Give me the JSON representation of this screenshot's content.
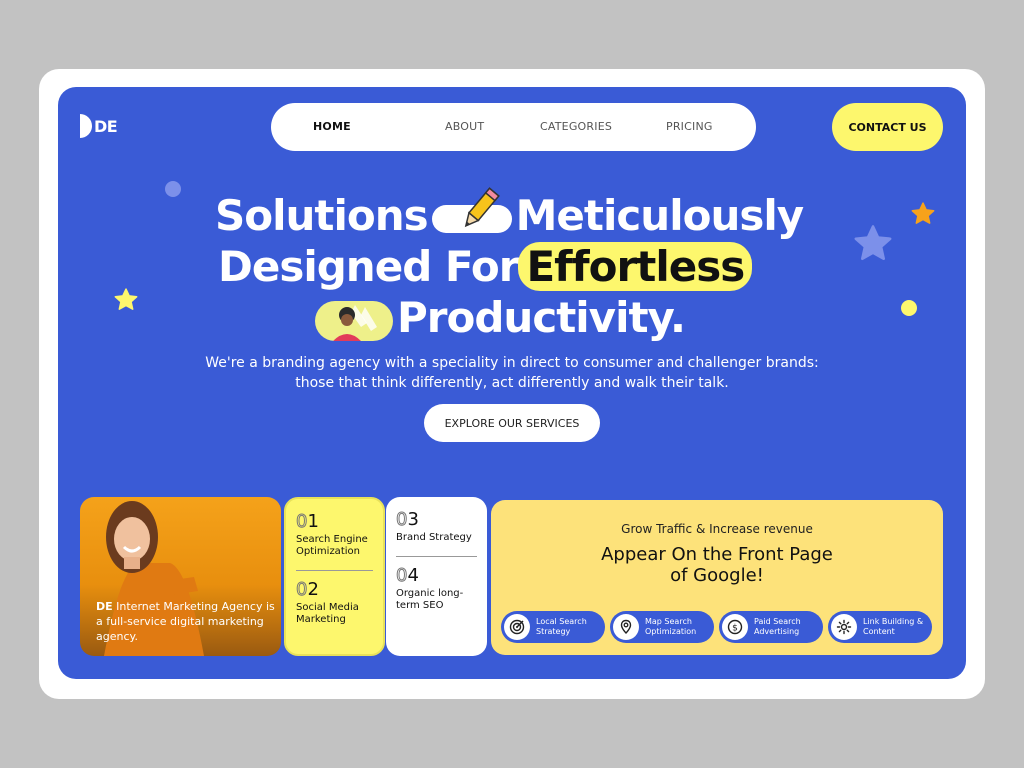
{
  "logo": {
    "text": "DE"
  },
  "nav": {
    "items": [
      {
        "label": "HOME",
        "active": true
      },
      {
        "label": "ABOUT",
        "active": false
      },
      {
        "label": "CATEGORIES",
        "active": false
      },
      {
        "label": "PRICING",
        "active": false
      }
    ]
  },
  "contact_button": "CONTACT US",
  "hero": {
    "headline_line1_a": "Solutions",
    "headline_line1_b": "Meticulously",
    "headline_line2_a": "Designed For",
    "headline_line2_b": "Effortless",
    "headline_line3": "Productivity.",
    "subtitle": "We're a branding agency with a speciality in direct to consumer and challenger brands: those that think differently, act differently and walk their talk.",
    "cta": "EXPLORE OUR SERVICES"
  },
  "agency_card": {
    "brand": "DE",
    "text": " Internet Marketing Agency is a full-service digital marketing agency."
  },
  "services": [
    {
      "num_ghost": "0",
      "num": "1",
      "label": "Search Engine Optimization"
    },
    {
      "num_ghost": "0",
      "num": "2",
      "label": "Social Media Marketing"
    },
    {
      "num_ghost": "0",
      "num": "3",
      "label": "Brand Strategy"
    },
    {
      "num_ghost": "0",
      "num": "4",
      "label": "Organic long-term SEO"
    }
  ],
  "seo_panel": {
    "kicker": "Grow Traffic & Increase revenue",
    "title_line1": "Appear On the Front Page",
    "title_line2": "of Google!",
    "chips": [
      {
        "label": "Local Search Strategy",
        "icon": "target-icon"
      },
      {
        "label": "Map Search Optimization",
        "icon": "map-pin-icon"
      },
      {
        "label": "Paid Search Advertising",
        "icon": "dollar-icon"
      },
      {
        "label": "Link Building & Content",
        "icon": "gear-icon"
      }
    ]
  },
  "colors": {
    "background": "#c2c2c2",
    "hero_blue": "#3a5bd6",
    "accent_yellow": "#fdf76d",
    "panel_yellow": "#fde27a",
    "orange": "#f5a21a"
  }
}
